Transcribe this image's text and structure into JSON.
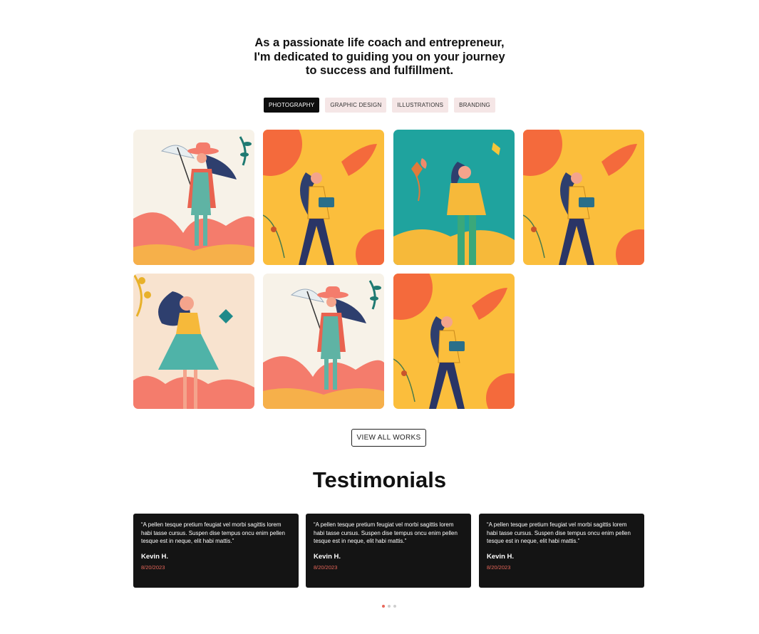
{
  "intro": {
    "lines": [
      "As a passionate life coach and entrepreneur,",
      "I'm dedicated to guiding you on your journey",
      "to success and fulfillment."
    ]
  },
  "filters": [
    {
      "label": "PHOTOGRAPHY",
      "active": true
    },
    {
      "label": "GRAPHIC DESIGN",
      "active": false
    },
    {
      "label": "ILLUSTRATIONS",
      "active": false
    },
    {
      "label": "BRANDING",
      "active": false
    }
  ],
  "gallery": [
    {
      "name": "woman-with-umbrella-illustration",
      "style": "umbrella"
    },
    {
      "name": "woman-with-laptop-illustration",
      "style": "laptop"
    },
    {
      "name": "woman-with-butterflies-illustration",
      "style": "teal"
    },
    {
      "name": "woman-with-laptop-illustration",
      "style": "laptop"
    },
    {
      "name": "woman-in-teal-dress-illustration",
      "style": "dress"
    },
    {
      "name": "woman-with-umbrella-illustration",
      "style": "umbrella"
    },
    {
      "name": "woman-with-laptop-illustration",
      "style": "laptop"
    }
  ],
  "view_all_label": "VIEW ALL WORKS",
  "testimonials": {
    "title": "Testimonials",
    "items": [
      {
        "quote": "“A pellen tesque pretium feugiat vel morbi sagittis lorem habi tasse cursus. Suspen dise tempus oncu enim pellen tesque est in neque, elit habi mattis.”",
        "author": "Kevin H.",
        "date": "8/20/2023"
      },
      {
        "quote": "“A pellen tesque pretium feugiat vel morbi sagittis lorem habi tasse cursus. Suspen dise tempus oncu enim pellen tesque est in neque, elit habi mattis.”",
        "author": "Kevin H.",
        "date": "8/20/2023"
      },
      {
        "quote": "“A pellen tesque pretium feugiat vel morbi sagittis lorem habi tasse cursus. Suspen dise tempus oncu enim pellen tesque est in neque, elit habi mattis.”",
        "author": "Kevin H.",
        "date": "8/20/2023"
      }
    ],
    "pagination": {
      "count": 3,
      "active": 0
    }
  },
  "colors": {
    "accent": "#e8675a",
    "dark": "#141414",
    "chip": "#f5e6e6"
  }
}
